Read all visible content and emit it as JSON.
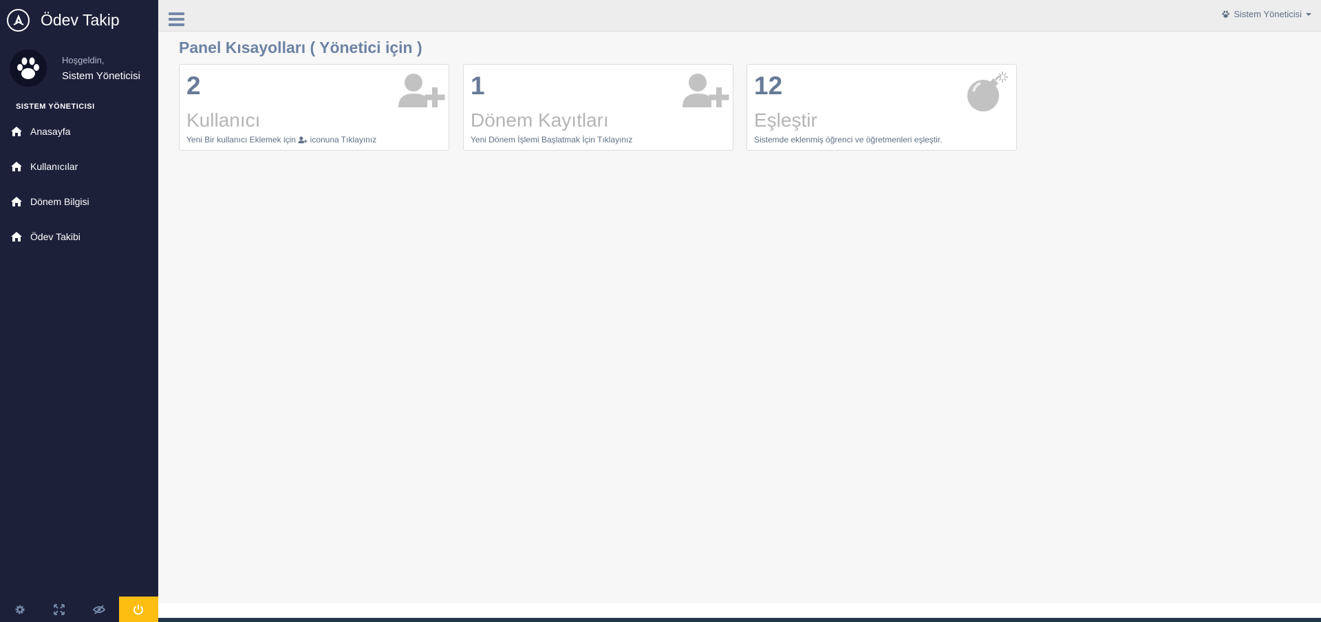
{
  "app": {
    "title": "Ödev Takip"
  },
  "profile": {
    "welcome": "Hoşgeldin,",
    "name": "Sistem Yöneticisi"
  },
  "sidebar": {
    "section_header": "SISTEM YÖNETICISI",
    "items": [
      {
        "label": "Anasayfa",
        "icon": "home-icon"
      },
      {
        "label": "Kullanıcılar",
        "icon": "home-icon"
      },
      {
        "label": "Dönem Bilgisi",
        "icon": "home-icon"
      },
      {
        "label": "Ödev Takibi",
        "icon": "home-icon"
      }
    ],
    "footer_icons": [
      "gear-icon",
      "fullscreen-icon",
      "eye-slash-icon",
      "power-icon"
    ]
  },
  "topbar": {
    "user_label": "Sistem Yöneticisi"
  },
  "page": {
    "title": "Panel Kısayolları ( Yönetici için )"
  },
  "cards": [
    {
      "number": "2",
      "name": "Kullanıcı",
      "desc_before": "Yeni Bir kullanıcı Eklemek için",
      "desc_after": "iconuna Tıklayınız",
      "icon": "user-plus-icon"
    },
    {
      "number": "1",
      "name": "Dönem Kayıtları",
      "desc": "Yeni Dönem İşlemi Başlatmak İçin Tıklayınız",
      "icon": "user-plus-icon"
    },
    {
      "number": "12",
      "name": "Eşleştir",
      "desc": "Sistemde eklenmiş öğrenci ve öğretmenleri eşleştir.",
      "icon": "bomb-icon"
    }
  ],
  "colors": {
    "sidebar_bg": "#1c2039",
    "accent_yellow": "#fdbe11",
    "title_blue": "#6d83a3",
    "number_gray_blue": "#687a96",
    "card_icon_gray": "#c2c2c2",
    "footer_line": "#22344a"
  }
}
